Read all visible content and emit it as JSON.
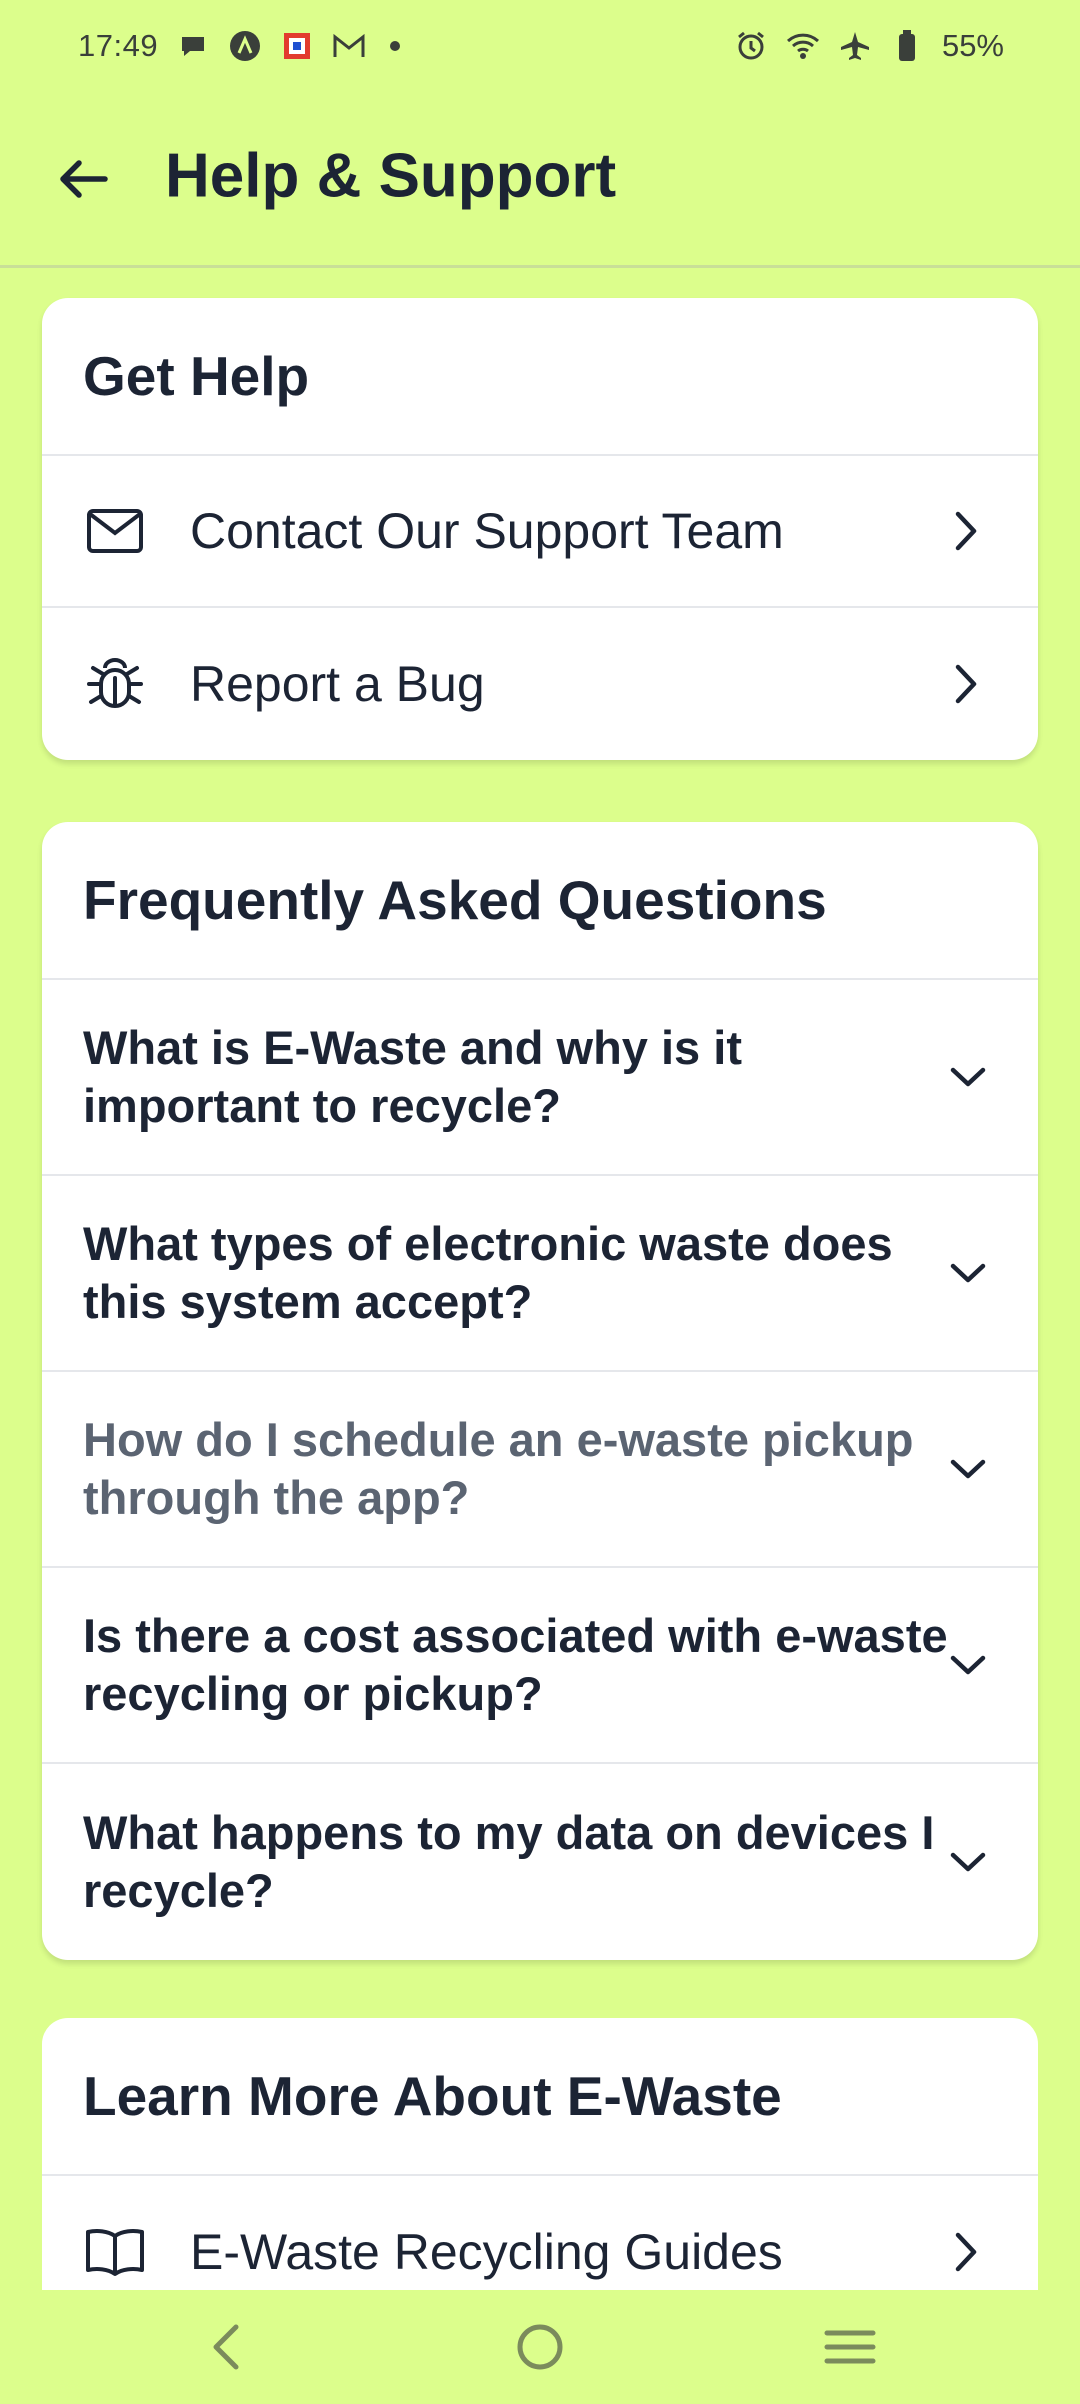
{
  "status_bar": {
    "time": "17:49",
    "battery": "55%",
    "left_icons": [
      "chat-icon",
      "a-badge-icon",
      "grid-app-icon",
      "gmail-icon",
      "dot-icon"
    ],
    "right_icons": [
      "alarm-icon",
      "wifi-icon",
      "airplane-icon",
      "battery-icon"
    ]
  },
  "header": {
    "title": "Help & Support"
  },
  "get_help": {
    "title": "Get Help",
    "items": [
      {
        "label": "Contact Our Support Team",
        "icon": "mail-icon"
      },
      {
        "label": "Report a Bug",
        "icon": "bug-icon"
      }
    ]
  },
  "faq": {
    "title": "Frequently Asked Questions",
    "items": [
      {
        "question": "What is E-Waste and why is it important to recycle?"
      },
      {
        "question": "What types of electronic waste does this system accept?"
      },
      {
        "question": "How do I schedule an e-waste pickup through the app?"
      },
      {
        "question": "Is there a cost associated with e-waste recycling or pickup?"
      },
      {
        "question": "What happens to my data on devices I recycle?"
      }
    ]
  },
  "learn_more": {
    "title": "Learn More About E-Waste",
    "items": [
      {
        "label": "E-Waste Recycling Guides",
        "icon": "book-icon"
      }
    ]
  },
  "colors": {
    "background": "#dcfe8c",
    "card": "#ffffff",
    "text": "#1c2434",
    "dim_text": "#5b6472"
  }
}
